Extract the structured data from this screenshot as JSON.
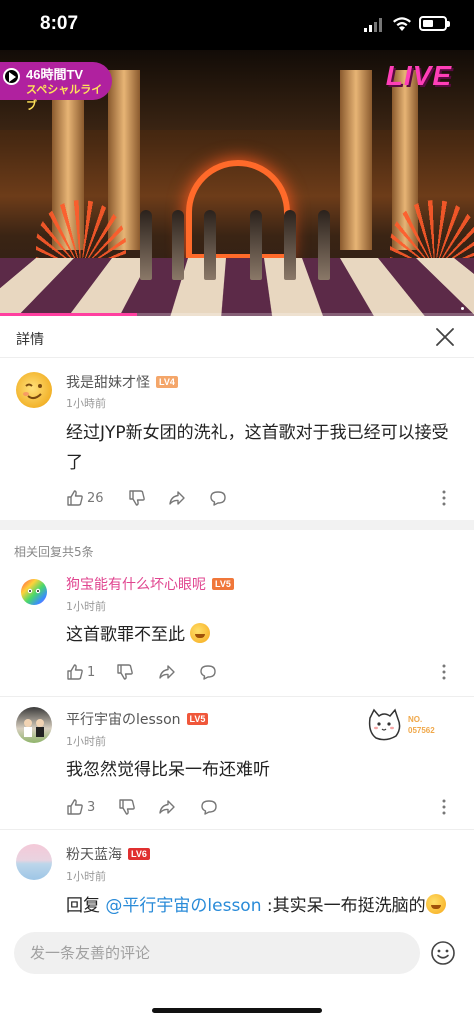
{
  "status_bar": {
    "time": "8:07",
    "battery_level": 0.5
  },
  "video": {
    "badge_title": "46時間TV",
    "badge_subtitle": "スペシャルライブ",
    "live_logo": "LIVE",
    "progress": 0.29
  },
  "detail": {
    "title": "詳情"
  },
  "main_comment": {
    "username": "我是甜妹才怪",
    "level": "LV4",
    "level_color": "#f4a66a",
    "time": "1小時前",
    "content": "经过JYP新女团的洗礼，这首歌对于我已经可以接受了",
    "likes": "26"
  },
  "related_label": "相关回复共5条",
  "replies": [
    {
      "username": "狗宝能有什么坏心眼呢",
      "username_color": "#e0458f",
      "level": "LV5",
      "level_color": "#f0773a",
      "time": "1小时前",
      "content": "这首歌罪不至此",
      "likes": "1"
    },
    {
      "username": "平行宇宙のlesson",
      "username_color": "#555555",
      "level": "LV5",
      "level_color": "#f0573a",
      "time": "1小时前",
      "content": "我忽然觉得比呆一布还难听",
      "likes": "3",
      "sticker_text_1": "NO.",
      "sticker_text_2": "057562"
    },
    {
      "username": "粉天蓝海",
      "username_color": "#555555",
      "level": "LV6",
      "level_color": "#e03030",
      "time": "1小时前",
      "content_prefix": "回复 ",
      "mention": "@平行宇宙のlesson",
      "content_suffix": " :其实呆一布挺洗脑的"
    }
  ],
  "input": {
    "placeholder": "发一条友善的评论"
  }
}
